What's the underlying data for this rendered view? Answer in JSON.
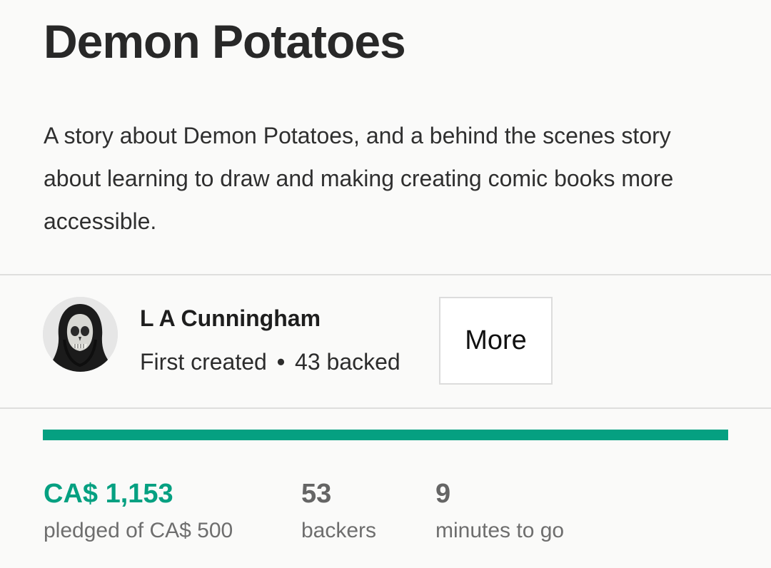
{
  "project": {
    "title": "Demon Potatoes",
    "blurb": "A story about Demon Potatoes, and a behind the scenes story about learning to draw and making creating comic books more accessible."
  },
  "creator": {
    "name": "L A Cunningham",
    "first_created": "First created",
    "separator": "•",
    "backed": "43 backed",
    "more_label": "More"
  },
  "funding": {
    "progress_percent": 100,
    "accent_color": "#05a081",
    "pledged_amount": "CA$ 1,153",
    "pledged_label": "pledged of CA$ 500",
    "backers_count": "53",
    "backers_label": "backers",
    "time_left": "9",
    "time_label": "minutes to go"
  }
}
